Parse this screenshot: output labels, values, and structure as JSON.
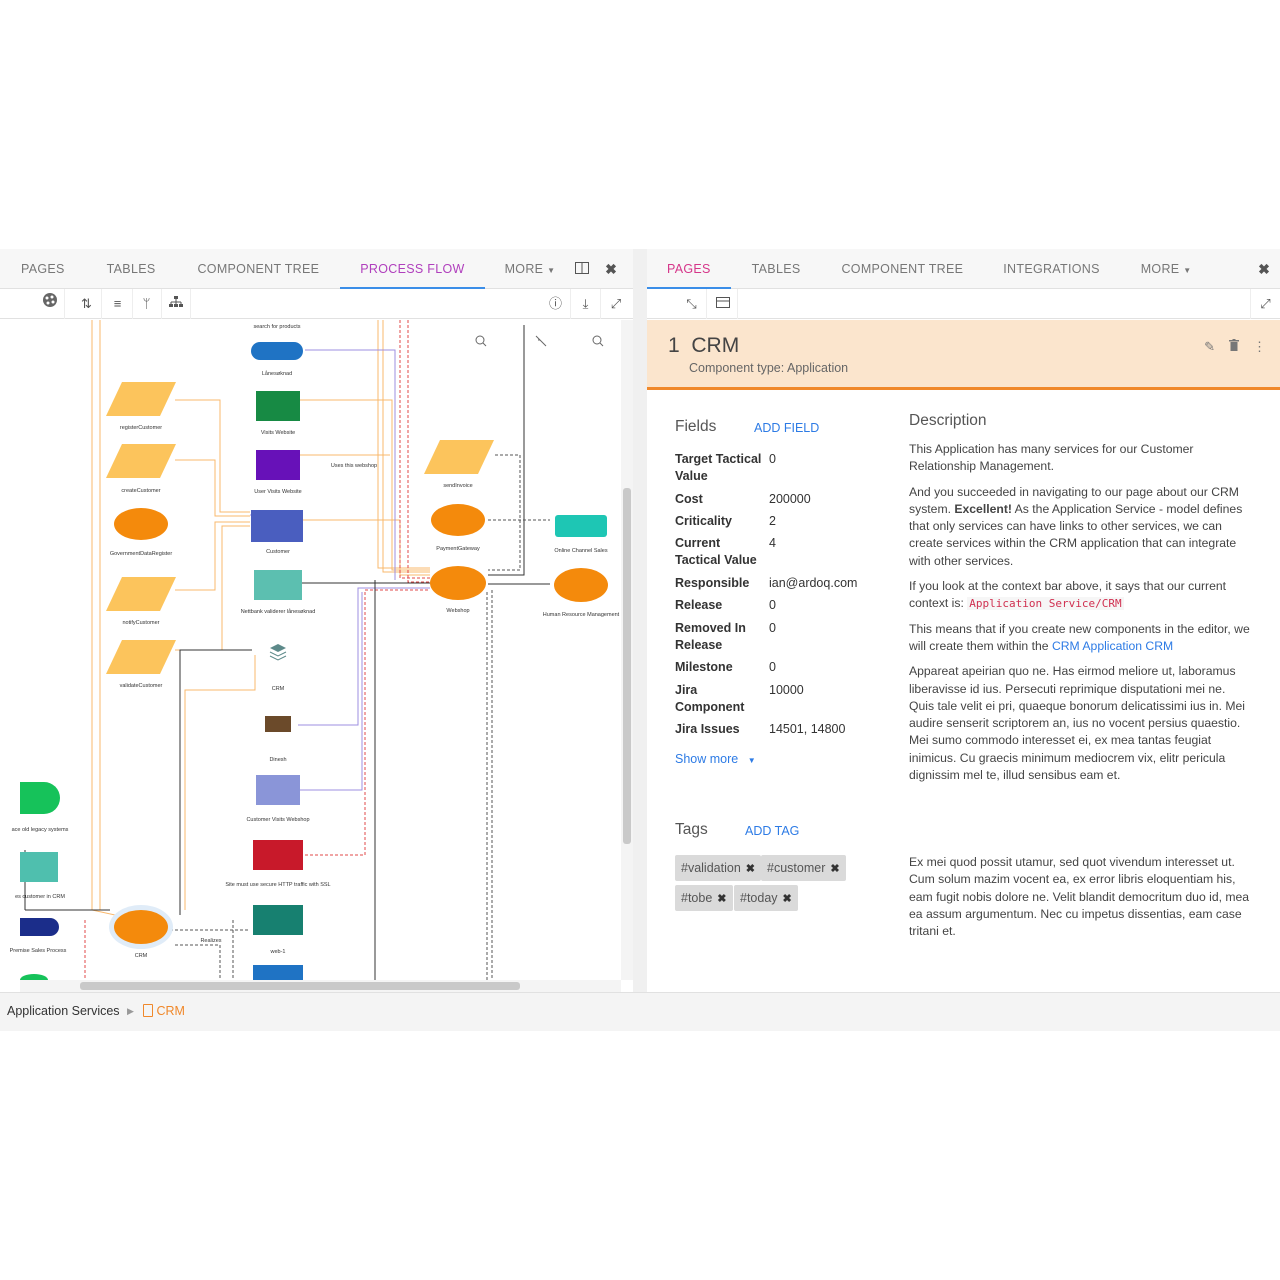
{
  "left_panel": {
    "tabs": [
      "PAGES",
      "TABLES",
      "COMPONENT TREE",
      "PROCESS FLOW",
      "MORE"
    ],
    "active_tab": "PROCESS FLOW",
    "toolbar_icons": [
      "palette-icon",
      "sort-asc-icon",
      "sort-desc-icon",
      "branch-icon",
      "hierarchy-icon",
      "info-icon",
      "download-icon",
      "expand-icon"
    ],
    "canvas_nodes": {
      "search_for_products": "search for products",
      "lanesoknad": "Lånesøknad",
      "visits_website": "Visits Website",
      "user_visits_website": "User Visits Website",
      "customer": "Customer",
      "nettbank": "Nettbank validerer lånesøknad",
      "crm_top": "CRM",
      "dinesh": "Dinesh",
      "customer_visits_webshop": "Customer Visits Webshop",
      "ssl": "Site must use secure HTTP traffic with SSL",
      "web1": "web-1",
      "register_customer": "registerCustomer",
      "create_customer": "createCustomer",
      "gov_data_register": "GovernmentDataRegister",
      "notify_customer": "notifyCustomer",
      "validate_customer": "validateCustomer",
      "send_invoice": "sendInvoice",
      "payment_gateway": "PaymentGateway",
      "webshop": "Webshop",
      "online_channel_sales": "Online Channel Sales",
      "hr_management": "Human Resource Management",
      "legacy": "ace old legacy systems",
      "customer_in_crm": "es customer in CRM",
      "premise_sales": "Premise Sales Process",
      "crm_bottom": "CRM",
      "uses_webshop": "Uses this webshop",
      "realizes": "Realizes"
    }
  },
  "right_panel": {
    "tabs": [
      "PAGES",
      "TABLES",
      "COMPONENT TREE",
      "INTEGRATIONS",
      "MORE"
    ],
    "active_tab": "PAGES",
    "component": {
      "index": "1",
      "name": "CRM",
      "type_label": "Component type: Application"
    },
    "fields_title": "Fields",
    "add_field": "ADD FIELD",
    "fields": [
      {
        "key": "Target Tactical Value",
        "value": "0"
      },
      {
        "key": "Cost",
        "value": "200000"
      },
      {
        "key": "Criticality",
        "value": "2"
      },
      {
        "key": "Current Tactical Value",
        "value": "4"
      },
      {
        "key": "Responsible",
        "value": "ian@ardoq.com"
      },
      {
        "key": "Release",
        "value": "0"
      },
      {
        "key": "Removed In Release",
        "value": "0"
      },
      {
        "key": "Milestone",
        "value": "0"
      },
      {
        "key": "Jira Component",
        "value": "10000"
      },
      {
        "key": "Jira Issues",
        "value": "14501, 14800"
      }
    ],
    "show_more": "Show more",
    "tags_title": "Tags",
    "add_tag": "ADD TAG",
    "tags": [
      "#validation",
      "#customer",
      "#tobe",
      "#today"
    ],
    "description_title": "Description",
    "description": {
      "p1": "This Application has many services for our Customer Relationship Management.",
      "p2_a": "And you succeeded in navigating to our page about our CRM system. ",
      "p2_b": "Excellent!",
      "p2_c": " As the Application Service - model defines that only services can have links to other services, we can create services within the CRM application that can integrate with other services.",
      "p3_a": "If you look at the context bar above, it says that our current context is: ",
      "p3_code": "Application Service/CRM",
      "p4_a": "This means that if you create new components in the editor, we will create them within the ",
      "p4_link": "CRM Application CRM",
      "p5": "Appareat apeirian quo ne. Has eirmod meliore ut, laboramus liberavisse id ius. Persecuti reprimique disputationi mei ne. Quis tale velit ei pri, quaeque bonorum delicatissimi ius in. Mei audire senserit scriptorem an, ius no vocent persius quaestio. Mei sumo commodo interesset ei, ex mea tantas feugiat inimicus. Cu graecis minimum mediocrem vix, elitr pericula dignissim mel te, illud sensibus eam et.",
      "p6": "Ex mei quod possit utamur, sed quot vivendum interesset ut. Cum solum mazim vocent ea, ex error libris eloquentiam his, eam fugit nobis dolore ne. Velit blandit democritum duo id, mea ea assum argumentum. Nec cu impetus dissentias, eam case tritani et."
    }
  },
  "footer": {
    "breadcrumb_root": "Application Services",
    "breadcrumb_current": "CRM"
  },
  "colors": {
    "accent": "#f0882a",
    "active_tab_left": "#b03fbd",
    "active_tab_right": "#d6368a",
    "link": "#2d7be5",
    "header_bg": "#fbe5cd"
  }
}
